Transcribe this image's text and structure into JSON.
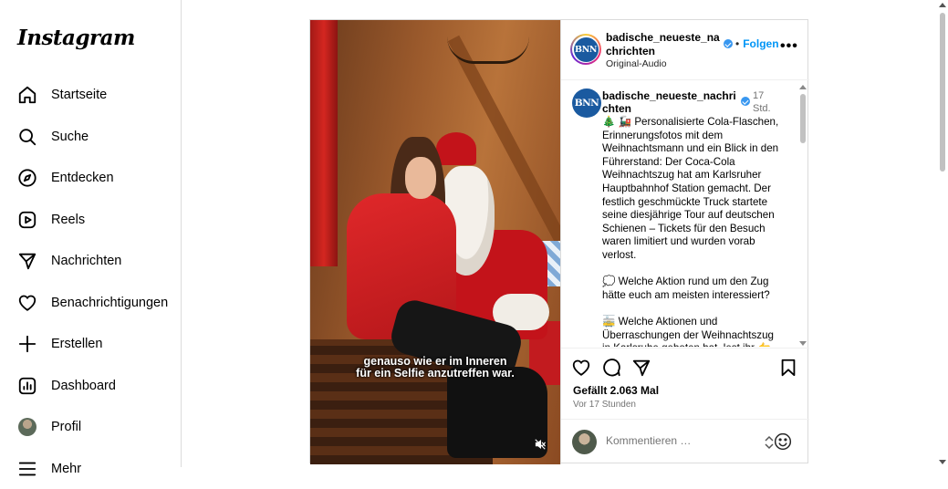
{
  "sidebar": {
    "logo": "Instagram",
    "items": [
      {
        "label": "Startseite",
        "icon": "home-icon"
      },
      {
        "label": "Suche",
        "icon": "search-icon"
      },
      {
        "label": "Entdecken",
        "icon": "compass-icon"
      },
      {
        "label": "Reels",
        "icon": "reels-icon"
      },
      {
        "label": "Nachrichten",
        "icon": "send-icon"
      },
      {
        "label": "Benachrichtigungen",
        "icon": "heart-icon"
      },
      {
        "label": "Erstellen",
        "icon": "plus-icon"
      },
      {
        "label": "Dashboard",
        "icon": "dashboard-icon"
      },
      {
        "label": "Profil",
        "icon": "profile-avatar"
      },
      {
        "label": "Mehr",
        "icon": "menu-icon"
      }
    ]
  },
  "post": {
    "media": {
      "caption_line1": "genauso wie er im Inneren",
      "caption_line2": "für ein Selfie anzutreffen war."
    },
    "header": {
      "avatar_text": "BNN",
      "username": "badische_neueste_nachrichten",
      "follow_label": "Folgen",
      "dot": "•",
      "audio": "Original-Audio",
      "more": "•••"
    },
    "comment": {
      "avatar_text": "BNN",
      "username": "badische_neueste_nachrichten",
      "time": "17 Std.",
      "text": "🎄 🚂 Personalisierte Cola-Flaschen, Erinnerungsfotos mit dem Weihnachtsmann und ein Blick in den Führerstand: Der Coca-Cola Weihnachtszug hat am Karlsruher Hauptbahnhof Station gemacht. Der festlich geschmückte Truck startete seine diesjährige Tour auf deutschen Schienen – Tickets für den Besuch waren limitiert und wurden vorab verlost.\n\n💭 Welche Aktion rund um den Zug hätte euch am meisten interessiert?\n\n🚋 Welche Aktionen und Überraschungen der Weihnachtszug in Karlsruhe geboten hat, lest ihr 👉 im"
    },
    "likes": "Gefällt 2.063 Mal",
    "ago": "Vor 17 Stunden",
    "comment_placeholder": "Kommentieren …"
  },
  "colors": {
    "link_blue": "#0095f6",
    "verified_blue": "#3897f0",
    "border": "#dbdbdb"
  }
}
